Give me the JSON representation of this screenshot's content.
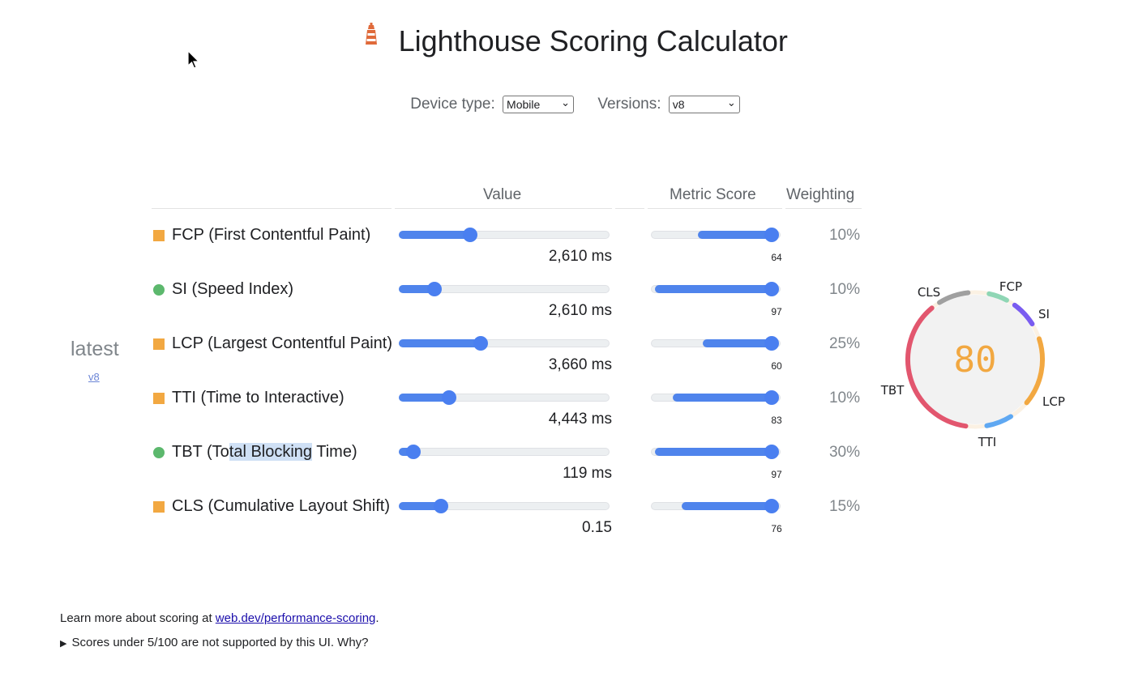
{
  "header": {
    "title": "Lighthouse Scoring Calculator",
    "logo_icon": "lighthouse-icon",
    "logo_color": "#e06a3a"
  },
  "controls": {
    "device_label": "Device type:",
    "device_value": "Mobile",
    "version_label": "Versions:",
    "version_value": "v8"
  },
  "table": {
    "headers": {
      "value": "Value",
      "metric_score": "Metric Score",
      "weighting": "Weighting"
    },
    "rows": [
      {
        "key": "fcp",
        "label": "FCP (First Contentful Paint)",
        "status": "average",
        "value_text": "2,610 ms",
        "value_fraction": 0.34,
        "score": "64",
        "score_fraction": 0.64,
        "weighting": "10%"
      },
      {
        "key": "si",
        "label": "SI (Speed Index)",
        "status": "good",
        "value_text": "2,610 ms",
        "value_fraction": 0.17,
        "score": "97",
        "score_fraction": 0.97,
        "weighting": "10%"
      },
      {
        "key": "lcp",
        "label": "LCP (Largest Contentful Paint)",
        "status": "average",
        "value_text": "3,660 ms",
        "value_fraction": 0.39,
        "score": "60",
        "score_fraction": 0.6,
        "weighting": "25%"
      },
      {
        "key": "tti",
        "label": "TTI (Time to Interactive)",
        "status": "average",
        "value_text": "4,443 ms",
        "value_fraction": 0.24,
        "score": "83",
        "score_fraction": 0.83,
        "weighting": "10%"
      },
      {
        "key": "tbt",
        "label_parts": [
          "TBT (To",
          "tal Blocking",
          " Time)"
        ],
        "status": "good",
        "value_text": "119 ms",
        "value_fraction": 0.07,
        "score": "97",
        "score_fraction": 0.97,
        "weighting": "30%"
      },
      {
        "key": "cls",
        "label": "CLS (Cumulative Layout Shift)",
        "status": "average",
        "value_text": "0.15",
        "value_fraction": 0.2,
        "score": "76",
        "score_fraction": 0.76,
        "weighting": "15%"
      }
    ]
  },
  "version_column": {
    "label": "latest",
    "link": "v8"
  },
  "gauge": {
    "score": "80",
    "score_color": "#f2a841",
    "labels": [
      "CLS",
      "FCP",
      "SI",
      "LCP",
      "TTI",
      "TBT"
    ],
    "segments": [
      {
        "metric": "FCP",
        "color": "#8fd6b5"
      },
      {
        "metric": "SI",
        "color": "#7a5cf0"
      },
      {
        "metric": "LCP",
        "color": "#f2a841"
      },
      {
        "metric": "TTI",
        "color": "#5fa8f2"
      },
      {
        "metric": "TBT",
        "color": "#e2566e"
      },
      {
        "metric": "CLS",
        "color": "#a0a0a0"
      }
    ]
  },
  "footer": {
    "learn_more_prefix": "Learn more about scoring at ",
    "learn_more_link": "web.dev/performance-scoring",
    "learn_more_suffix": ".",
    "note": "Scores under 5/100 are not supported by this UI. Why?"
  }
}
